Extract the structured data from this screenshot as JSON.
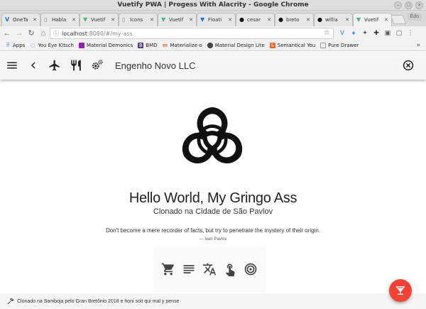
{
  "window": {
    "title": "Vuetify PWA | Progess With Alacrity - Google Chrome",
    "profile": "Édo"
  },
  "tabs": [
    {
      "label": "OneTa",
      "favicon": "v-icon",
      "active": false
    },
    {
      "label": "Habla",
      "favicon": "page-icon",
      "active": false
    },
    {
      "label": "Vuetif",
      "favicon": "vuetify-icon",
      "active": false
    },
    {
      "label": "Icons",
      "favicon": "page-icon",
      "active": false
    },
    {
      "label": "Vuetif",
      "favicon": "vuetify-icon",
      "active": false
    },
    {
      "label": "Floati",
      "favicon": "vuetify-blue-icon",
      "active": false
    },
    {
      "label": "cesar",
      "favicon": "github-icon",
      "active": false
    },
    {
      "label": "breto",
      "favicon": "github-icon",
      "active": false
    },
    {
      "label": "willia",
      "favicon": "github-icon",
      "active": false
    },
    {
      "label": "Vuetif",
      "favicon": "vuetify-icon",
      "active": true
    }
  ],
  "address": {
    "host": "localhost",
    "path": ":8080/#/my-ass"
  },
  "bookmarks": [
    {
      "label": "Apps",
      "color": "#4285f4"
    },
    {
      "label": "You Eye Kitsch",
      "color": "#1e88e5"
    },
    {
      "label": "Material Demonics",
      "color": "#8e24aa"
    },
    {
      "label": "BMD",
      "color": "#563d7c"
    },
    {
      "label": "Materialize-o",
      "color": "#ee6e73"
    },
    {
      "label": "Material Design Lite",
      "color": "#444444"
    },
    {
      "label": "Semantical You",
      "color": "#f26522"
    },
    {
      "label": "Pure Drawer",
      "color": "#999999"
    }
  ],
  "appbar": {
    "title": "Engenho Novo LLC"
  },
  "main": {
    "headline": "Hello World, My Gringo Ass",
    "subhead": "Clonado na Cidade de São Pavlov",
    "quote": "Don't become a mere recorder of facts, but try to penetrate the mystery of their origin.",
    "author": "— Ivan Pavlov",
    "actions": [
      "cart-icon",
      "list-icon",
      "translate-icon",
      "touch-icon",
      "target-icon"
    ]
  },
  "footer": {
    "text": "Clonado na Samboja pelo Gran Bretônio 2018 e honi soit qui mal y pense"
  },
  "colors": {
    "fab": "#f44336",
    "vuetify_green": "#41b883",
    "appbar_bg": "#f5f5f5"
  }
}
